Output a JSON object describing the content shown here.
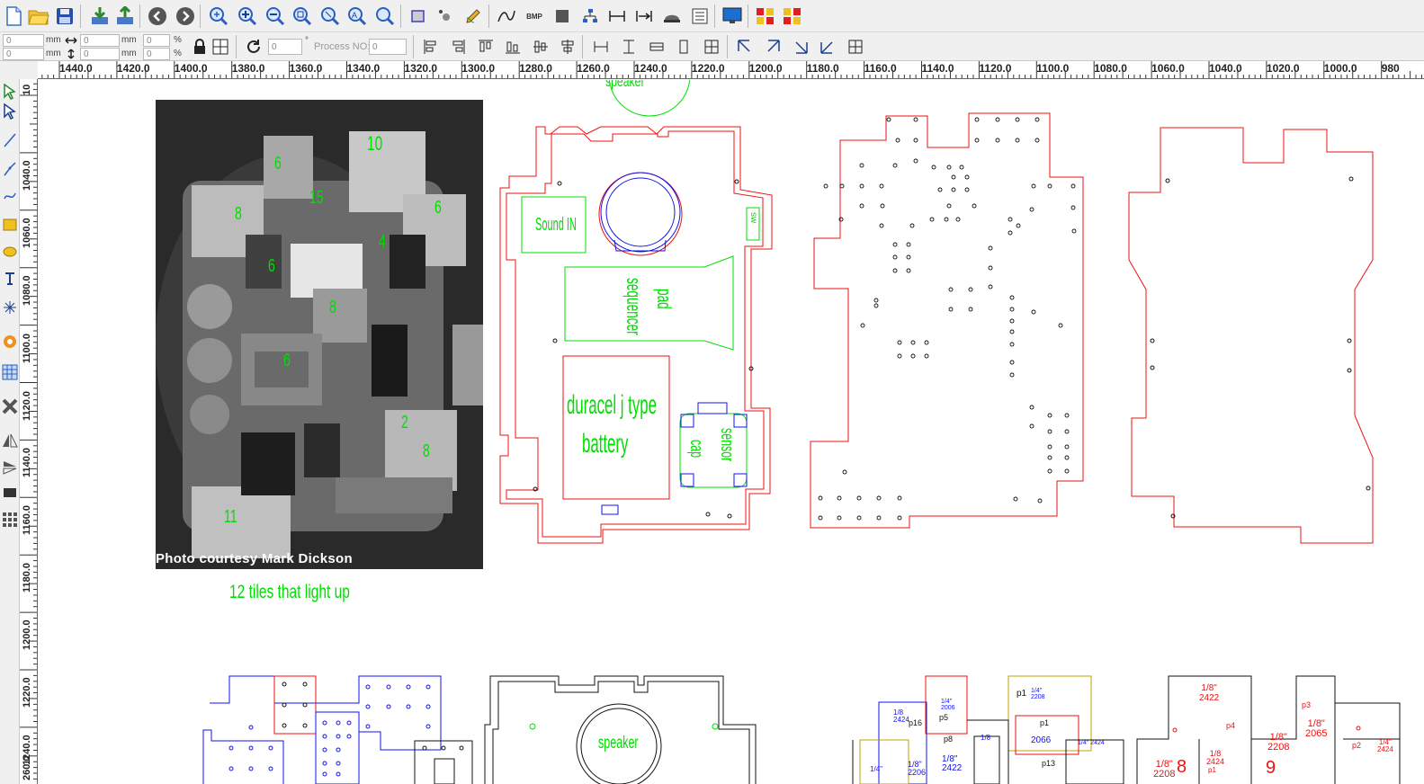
{
  "toolbar1": {
    "icons": [
      "new-file-icon",
      "open-folder-icon",
      "save-icon",
      "import-icon",
      "export-icon",
      "back-icon",
      "forward-icon",
      "zoom-in-icon",
      "zoom-in-plus-icon",
      "zoom-out-icon",
      "zoom-extents-icon",
      "zoom-window-icon",
      "zoom-all-icon",
      "zoom-previous-icon",
      "rectangle-select-icon",
      "node-edit-icon",
      "pen-edit-icon",
      "curve-icon",
      "bmp-icon",
      "fill-icon",
      "tree-icon",
      "measure-h-icon",
      "measure-arrow-icon",
      "laser-head-icon",
      "layer-list-icon",
      "monitor-icon",
      "array-icon",
      "array-2-icon"
    ],
    "bmp_label": "BMP"
  },
  "toolbar2": {
    "x_value": "0",
    "y_value": "0",
    "w_value": "0",
    "h_value": "0",
    "sx_value": "0",
    "sy_value": "0",
    "unit_mm": "mm",
    "unit_pct": "%",
    "rotate_value": "0",
    "degree_symbol": "°",
    "process_label": "Process NO:",
    "process_value": "0"
  },
  "ruler": {
    "h_labels": [
      "1440.0",
      "1420.0",
      "1400.0",
      "1380.0",
      "1360.0",
      "1340.0",
      "1320.0",
      "1300.0",
      "1280.0",
      "1260.0",
      "1240.0",
      "1220.0",
      "1200.0",
      "1180.0",
      "1160.0",
      "1140.0",
      "1120.0",
      "1100.0",
      "1080.0",
      "1060.0",
      "1040.0",
      "1020.0",
      "1000.0",
      "980"
    ],
    "v_labels": [
      "10",
      "1040.0",
      "1060.0",
      "1080.0",
      "1100.0",
      "1120.0",
      "1140.0",
      "1160.0",
      "1180.0",
      "1200.0",
      "1220.0",
      "1240.0",
      "260.0"
    ]
  },
  "canvas": {
    "photo_credit": "Photo courtesy Mark Dickson",
    "tiles_caption": "12 tiles that light up",
    "photo_numbers": [
      "6",
      "10",
      "8",
      "15",
      "6",
      "4",
      "6",
      "8",
      "6",
      "2",
      "8",
      "11"
    ],
    "labels": {
      "speaker_top": "speaker",
      "sound": "Sound IN",
      "switch": "sw",
      "sequencer": "sequencer",
      "pad": "pad",
      "battery_1": "duracel j type",
      "battery_2": "battery",
      "cap": "cap",
      "sensor": "sensor",
      "speaker_bottom": "speaker"
    },
    "mini_labels": {
      "l1": "1/8",
      "l2": "2424",
      "l3": "p16",
      "l4": "p1",
      "l5": "1/4\"",
      "l6": "2006",
      "l7": "p5",
      "l8": "p1",
      "l9": "1/4\"",
      "l10": "2208",
      "l11": "1/8\"",
      "l12": "2206",
      "l13": "1/4\"",
      "l14": "1/8\"",
      "l15": "2422",
      "l16": "1/8",
      "l17": "p8",
      "l18": "p13",
      "l19": "2066",
      "l20": "1/4\"",
      "l21": "2424"
    },
    "red_labels": {
      "r1": "1/8\"",
      "r2": "2422",
      "r3": "p4",
      "r4": "p3",
      "r5": "1/8\"",
      "r6": "2065",
      "r7": "1/8\"",
      "r8": "2208",
      "r9": "p1",
      "r10": "1/8\"",
      "r11": "2208",
      "r12": "8",
      "r13": "1/8",
      "r14": "2424",
      "r15": "9",
      "r16": "p2",
      "r17": "1/4\"",
      "r18": "2424"
    }
  },
  "colors": {
    "outline_red": "#ee1111",
    "outline_green": "#00dd00",
    "outline_blue": "#1111ee",
    "outline_black": "#111111",
    "photo_bg": "#1f1f1f"
  }
}
